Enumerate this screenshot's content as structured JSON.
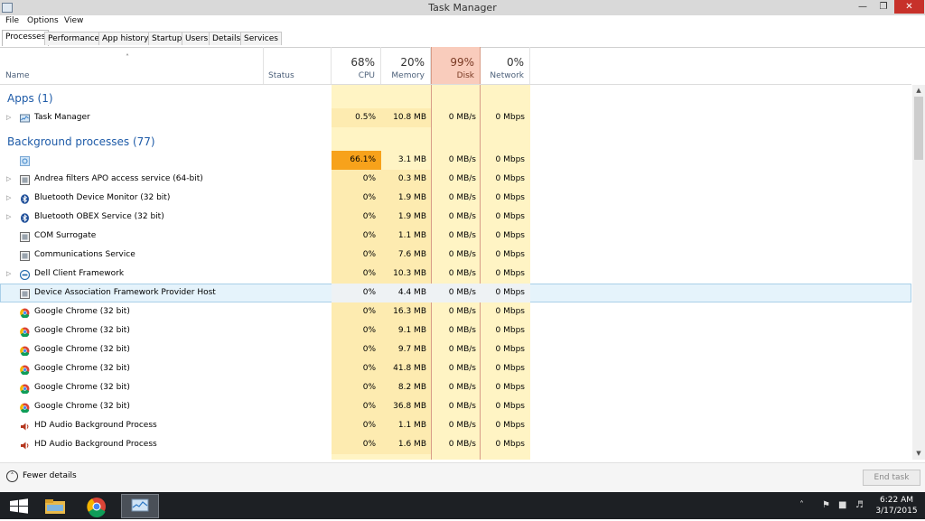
{
  "window": {
    "title": "Task Manager"
  },
  "menu": [
    "File",
    "Options",
    "View"
  ],
  "tabs": [
    "Processes",
    "Performance",
    "App history",
    "Startup",
    "Users",
    "Details",
    "Services"
  ],
  "header": {
    "name": "Name",
    "status": "Status",
    "cpu": {
      "pct": "68%",
      "label": "CPU"
    },
    "memory": {
      "pct": "20%",
      "label": "Memory"
    },
    "disk": {
      "pct": "99%",
      "label": "Disk"
    },
    "network": {
      "pct": "0%",
      "label": "Network"
    }
  },
  "groups": {
    "apps": "Apps (1)",
    "background": "Background processes (77)"
  },
  "apps": [
    {
      "name": "Task Manager",
      "cpu": "0.5%",
      "mem": "10.8 MB",
      "disk": "0 MB/s",
      "net": "0 Mbps",
      "icon": "task-manager-icon"
    }
  ],
  "processes": [
    {
      "name": "",
      "cpu": "66.1%",
      "mem": "3.1 MB",
      "disk": "0 MB/s",
      "net": "0 Mbps",
      "icon": "generic-process-icon"
    },
    {
      "name": "Andrea filters APO access service (64-bit)",
      "cpu": "0%",
      "mem": "0.3 MB",
      "disk": "0 MB/s",
      "net": "0 Mbps",
      "icon": "service-icon"
    },
    {
      "name": "Bluetooth Device Monitor (32 bit)",
      "cpu": "0%",
      "mem": "1.9 MB",
      "disk": "0 MB/s",
      "net": "0 Mbps",
      "icon": "bluetooth-icon"
    },
    {
      "name": "Bluetooth OBEX Service (32 bit)",
      "cpu": "0%",
      "mem": "1.9 MB",
      "disk": "0 MB/s",
      "net": "0 Mbps",
      "icon": "bluetooth-icon"
    },
    {
      "name": "COM Surrogate",
      "cpu": "0%",
      "mem": "1.1 MB",
      "disk": "0 MB/s",
      "net": "0 Mbps",
      "icon": "service-icon"
    },
    {
      "name": "Communications Service",
      "cpu": "0%",
      "mem": "7.6 MB",
      "disk": "0 MB/s",
      "net": "0 Mbps",
      "icon": "service-icon"
    },
    {
      "name": "Dell Client Framework",
      "cpu": "0%",
      "mem": "10.3 MB",
      "disk": "0 MB/s",
      "net": "0 Mbps",
      "icon": "dell-icon"
    },
    {
      "name": "Device Association Framework Provider Host",
      "cpu": "0%",
      "mem": "4.4 MB",
      "disk": "0 MB/s",
      "net": "0 Mbps",
      "icon": "service-icon"
    },
    {
      "name": "Google Chrome (32 bit)",
      "cpu": "0%",
      "mem": "16.3 MB",
      "disk": "0 MB/s",
      "net": "0 Mbps",
      "icon": "chrome-icon"
    },
    {
      "name": "Google Chrome (32 bit)",
      "cpu": "0%",
      "mem": "9.1 MB",
      "disk": "0 MB/s",
      "net": "0 Mbps",
      "icon": "chrome-icon"
    },
    {
      "name": "Google Chrome (32 bit)",
      "cpu": "0%",
      "mem": "9.7 MB",
      "disk": "0 MB/s",
      "net": "0 Mbps",
      "icon": "chrome-icon"
    },
    {
      "name": "Google Chrome (32 bit)",
      "cpu": "0%",
      "mem": "41.8 MB",
      "disk": "0 MB/s",
      "net": "0 Mbps",
      "icon": "chrome-icon"
    },
    {
      "name": "Google Chrome (32 bit)",
      "cpu": "0%",
      "mem": "8.2 MB",
      "disk": "0 MB/s",
      "net": "0 Mbps",
      "icon": "chrome-icon"
    },
    {
      "name": "Google Chrome (32 bit)",
      "cpu": "0%",
      "mem": "36.8 MB",
      "disk": "0 MB/s",
      "net": "0 Mbps",
      "icon": "chrome-icon"
    },
    {
      "name": "HD Audio Background Process",
      "cpu": "0%",
      "mem": "1.1 MB",
      "disk": "0 MB/s",
      "net": "0 Mbps",
      "icon": "speaker-icon"
    },
    {
      "name": "HD Audio Background Process",
      "cpu": "0%",
      "mem": "1.6 MB",
      "disk": "0 MB/s",
      "net": "0 Mbps",
      "icon": "speaker-icon"
    }
  ],
  "footer": {
    "fewer_details": "Fewer details",
    "end_task": "End task"
  },
  "taskbar": {
    "time": "6:22 AM",
    "date": "3/17/2015"
  },
  "colors": {
    "cpu_high": "#f7a21b",
    "light_yellow": "#fff4c4",
    "mid_yellow": "#fdebb0",
    "disk_header": "#f9ccbc",
    "group_blue": "#1e5ba8"
  }
}
